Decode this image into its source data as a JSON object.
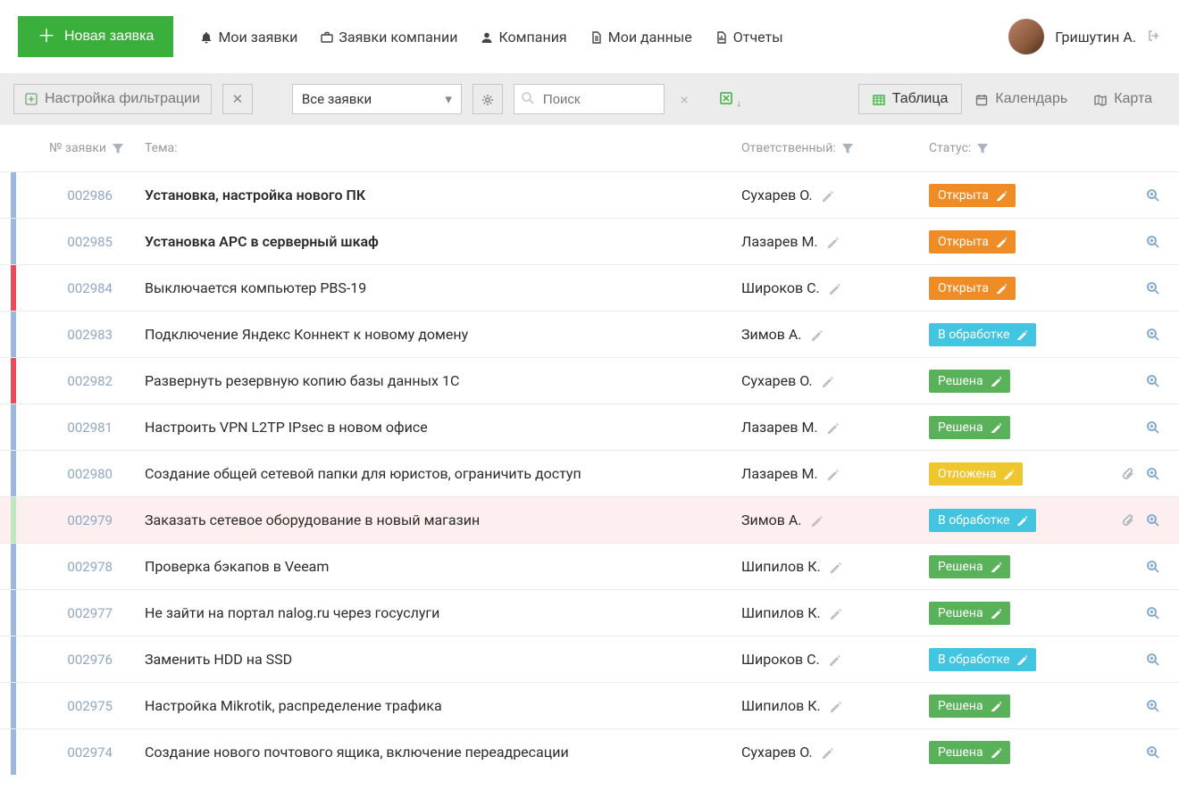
{
  "header": {
    "new_ticket_label": "Новая заявка",
    "nav": [
      {
        "icon": "bell-icon",
        "label": "Мои заявки"
      },
      {
        "icon": "briefcase-icon",
        "label": "Заявки компании"
      },
      {
        "icon": "user-icon",
        "label": "Компания"
      },
      {
        "icon": "file-icon",
        "label": "Мои данные"
      },
      {
        "icon": "report-icon",
        "label": "Отчеты"
      }
    ],
    "user_name": "Гришутин А."
  },
  "toolbar": {
    "filter_setup_label": "Настройка фильтрации",
    "dropdown_value": "Все заявки",
    "search_placeholder": "Поиск",
    "views": {
      "table": "Таблица",
      "calendar": "Календарь",
      "map": "Карта"
    }
  },
  "columns": {
    "number": "№ заявки",
    "subject": "Тема:",
    "responsible": "Ответственный:",
    "status": "Статус:"
  },
  "status_labels": {
    "open": "Открыта",
    "processing": "В обработке",
    "solved": "Решена",
    "postponed": "Отложена"
  },
  "rows": [
    {
      "id": "002986",
      "subject": "Установка, настройка нового ПК",
      "responsible": "Сухарев О.",
      "status": "open",
      "bold": true,
      "priority": "blue",
      "attachment": false
    },
    {
      "id": "002985",
      "subject": "Установка APC в серверный шкаф",
      "responsible": "Лазарев М.",
      "status": "open",
      "bold": true,
      "priority": "blue",
      "attachment": false
    },
    {
      "id": "002984",
      "subject": "Выключается компьютер PBS-19",
      "responsible": "Широков С.",
      "status": "open",
      "bold": false,
      "priority": "red",
      "attachment": false
    },
    {
      "id": "002983",
      "subject": "Подключение Яндекс Коннект к новому домену",
      "responsible": "Зимов А.",
      "status": "processing",
      "bold": false,
      "priority": "blue",
      "attachment": false
    },
    {
      "id": "002982",
      "subject": "Развернуть резервную копию базы данных 1С",
      "responsible": "Сухарев О.",
      "status": "solved",
      "bold": false,
      "priority": "red",
      "attachment": false
    },
    {
      "id": "002981",
      "subject": "Настроить VPN L2TP IPsec в новом офисе",
      "responsible": "Лазарев М.",
      "status": "solved",
      "bold": false,
      "priority": "blue",
      "attachment": false
    },
    {
      "id": "002980",
      "subject": "Создание общей сетевой папки для юристов, ограничить доступ",
      "responsible": "Лазарев М.",
      "status": "postponed",
      "bold": false,
      "priority": "blue",
      "attachment": true
    },
    {
      "id": "002979",
      "subject": "Заказать сетевое оборудование в новый магазин",
      "responsible": "Зимов А.",
      "status": "processing",
      "bold": false,
      "priority": "green",
      "attachment": true,
      "highlighted": true
    },
    {
      "id": "002978",
      "subject": "Проверка бэкапов в Veeam",
      "responsible": "Шипилов К.",
      "status": "solved",
      "bold": false,
      "priority": "blue",
      "attachment": false
    },
    {
      "id": "002977",
      "subject": "Не зайти на портал nalog.ru через госуслуги",
      "responsible": "Шипилов К.",
      "status": "solved",
      "bold": false,
      "priority": "blue",
      "attachment": false
    },
    {
      "id": "002976",
      "subject": "Заменить HDD на SSD",
      "responsible": "Широков С.",
      "status": "processing",
      "bold": false,
      "priority": "blue",
      "attachment": false
    },
    {
      "id": "002975",
      "subject": "Настройка Mikrotik, распределение трафика",
      "responsible": "Шипилов К.",
      "status": "solved",
      "bold": false,
      "priority": "blue",
      "attachment": false
    },
    {
      "id": "002974",
      "subject": "Создание нового почтового ящика, включение переадресации",
      "responsible": "Сухарев О.",
      "status": "solved",
      "bold": false,
      "priority": "blue",
      "attachment": false
    }
  ]
}
